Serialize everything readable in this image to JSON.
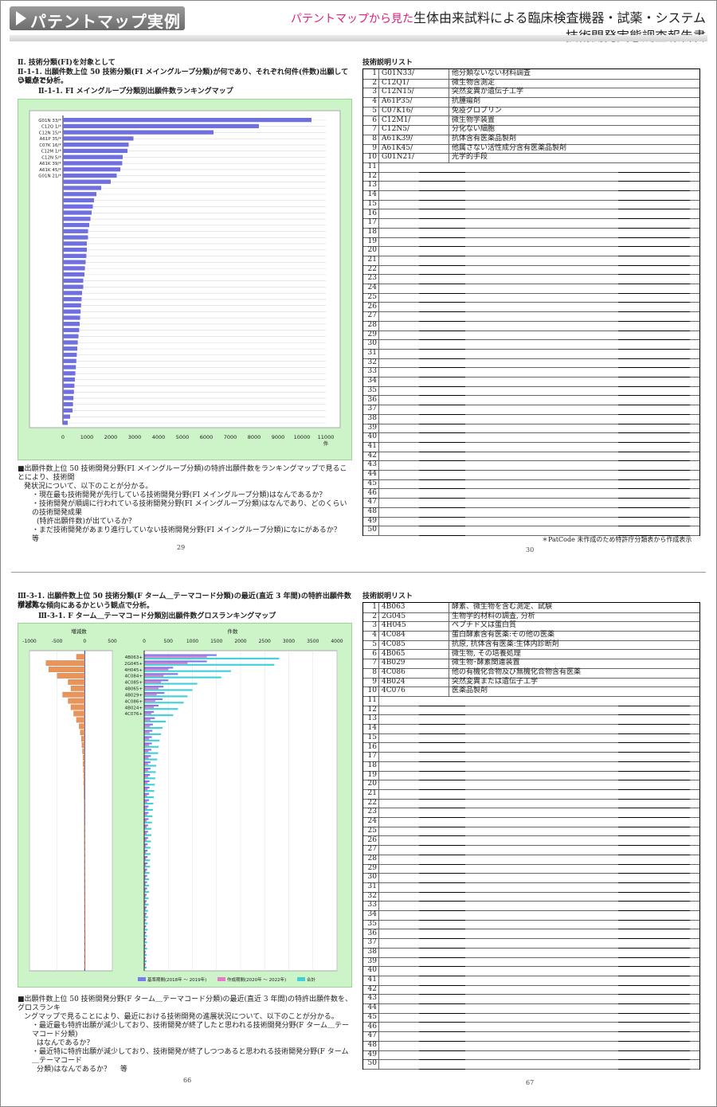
{
  "header": {
    "badge": "パテントマップ実例",
    "subtitle_pink": "パテントマップから見た",
    "title_line1": "生体由来試料による臨床検査機器・試薬・システム",
    "title_line2": "技術開発実態調査報告書"
  },
  "page1": {
    "section": "Ⅱ. 技術分類(FI)を対象として",
    "heading": "Ⅱ-1-1. 出願件数上位 50 技術分類(FI メイングループ分類)が何であり、それぞれ何件(件数)出願しているかとい",
    "heading2": "う観点で分析。",
    "chart_caption": "Ⅱ-1-1. FI メイングループ分類別出願件数ランキングマップ",
    "unit": "件",
    "notes": [
      "■出願件数上位 50 技術開発分野(FI メイングループ分類)の特許出願件数をランキングマップで見ることにより、技術開",
      "発状況について、以下のことが分かる。",
      "・現在最も技術開発が先行している技術開発分野(FI メイングループ分類)はなんであるか？",
      "・技術開発が順調に行われている技術開発分野(FI メイングループ分類)はなんであり、どのくらいの技術開発成果",
      "(特許出願件数)が出ているか？",
      "・まだ技術開発があまり進行していない技術開発分野(FI メイングループ分類)になにがあるか？　 等"
    ],
    "page_left": "29",
    "page_right": "30"
  },
  "techlist1": {
    "title": "技術説明リスト",
    "footnote": "＊PatCode 未作成のため特許庁分類表から作成表示",
    "rows": [
      {
        "n": "1",
        "code": "G01N33/",
        "desc": "他分類ないない材料調査"
      },
      {
        "n": "2",
        "code": "C12Q1/",
        "desc": "微生物含測定"
      },
      {
        "n": "3",
        "code": "C12N15/",
        "desc": "突然変異か遺伝子工学"
      },
      {
        "n": "4",
        "code": "A61P35/",
        "desc": "抗腫瘍剤"
      },
      {
        "n": "5",
        "code": "C07K16/",
        "desc": "免疫グロブリン"
      },
      {
        "n": "6",
        "code": "C12M1/",
        "desc": "微生物学装置"
      },
      {
        "n": "7",
        "code": "C12N5/",
        "desc": "分化ない細胞"
      },
      {
        "n": "8",
        "code": "A61K39/",
        "desc": "抗体含有医薬品製剤"
      },
      {
        "n": "9",
        "code": "A61K45/",
        "desc": "他属さない活性成分含有医薬品製剤"
      },
      {
        "n": "10",
        "code": "G01N21/",
        "desc": "光学的手段"
      },
      {
        "n": "11",
        "code": "",
        "desc": ""
      },
      {
        "n": "12",
        "code": "",
        "desc": ""
      },
      {
        "n": "13",
        "code": "",
        "desc": ""
      },
      {
        "n": "14",
        "code": "",
        "desc": ""
      },
      {
        "n": "15",
        "code": "",
        "desc": ""
      },
      {
        "n": "16",
        "code": "",
        "desc": ""
      },
      {
        "n": "17",
        "code": "",
        "desc": ""
      },
      {
        "n": "18",
        "code": "",
        "desc": ""
      },
      {
        "n": "19",
        "code": "",
        "desc": ""
      },
      {
        "n": "20",
        "code": "",
        "desc": ""
      },
      {
        "n": "21",
        "code": "",
        "desc": ""
      },
      {
        "n": "22",
        "code": "",
        "desc": ""
      },
      {
        "n": "23",
        "code": "",
        "desc": ""
      },
      {
        "n": "24",
        "code": "",
        "desc": ""
      },
      {
        "n": "25",
        "code": "",
        "desc": ""
      },
      {
        "n": "26",
        "code": "",
        "desc": ""
      },
      {
        "n": "27",
        "code": "",
        "desc": ""
      },
      {
        "n": "28",
        "code": "",
        "desc": ""
      },
      {
        "n": "29",
        "code": "",
        "desc": ""
      },
      {
        "n": "30",
        "code": "",
        "desc": ""
      },
      {
        "n": "31",
        "code": "",
        "desc": ""
      },
      {
        "n": "32",
        "code": "",
        "desc": ""
      },
      {
        "n": "33",
        "code": "",
        "desc": ""
      },
      {
        "n": "34",
        "code": "",
        "desc": ""
      },
      {
        "n": "35",
        "code": "",
        "desc": ""
      },
      {
        "n": "36",
        "code": "",
        "desc": ""
      },
      {
        "n": "37",
        "code": "",
        "desc": ""
      },
      {
        "n": "38",
        "code": "",
        "desc": ""
      },
      {
        "n": "39",
        "code": "",
        "desc": ""
      },
      {
        "n": "40",
        "code": "",
        "desc": ""
      },
      {
        "n": "41",
        "code": "",
        "desc": ""
      },
      {
        "n": "42",
        "code": "",
        "desc": ""
      },
      {
        "n": "43",
        "code": "",
        "desc": ""
      },
      {
        "n": "44",
        "code": "",
        "desc": ""
      },
      {
        "n": "45",
        "code": "",
        "desc": ""
      },
      {
        "n": "46",
        "code": "",
        "desc": ""
      },
      {
        "n": "47",
        "code": "",
        "desc": ""
      },
      {
        "n": "48",
        "code": "",
        "desc": ""
      },
      {
        "n": "49",
        "code": "",
        "desc": ""
      },
      {
        "n": "50",
        "code": "",
        "desc": ""
      }
    ]
  },
  "page2": {
    "heading": "Ⅲ-3-1. 出願件数上位 50 技術分類(F ターム＿テーマコード分類)の最近(直近 3 年間)の特許出願件数増減数",
    "heading2": "がどんな傾向にあるかという観点で分析。",
    "chart_caption": "Ⅲ-3-1. F ターム＿テーマコード分類別出願件数グロスランキングマップ",
    "left_axis_title": "増減数",
    "right_axis_title": "件数",
    "notes": [
      "■出願件数上位 50 技術開発分野(F ターム＿テーマコード分類)の最近(直近 3 年間)の特許出願件数を、グロスランキ",
      "ングマップで見ることにより、最近における技術開発の進展状況について、以下のことが分かる。",
      "・最近最も特許出願が減少しており、技術開発が終了したと思われる技術開発分野(F ターム＿テーマコード分類)",
      "はなんであるか？",
      "・最近特に特許出願が減少しており、技術開発が終了しつつあると思われる技術開発分野(F ターム＿テーマコード",
      "分類)はなんであるか？　 等"
    ],
    "page_left": "66",
    "page_right": "67"
  },
  "techlist2": {
    "title": "技術説明リスト",
    "rows": [
      {
        "n": "1",
        "code": "4B063",
        "desc": "酵素、微生物を含む測定、試験"
      },
      {
        "n": "2",
        "code": "2G045",
        "desc": "生物学的材料の調査, 分析"
      },
      {
        "n": "3",
        "code": "4H045",
        "desc": "ペプチド又は蛋白質"
      },
      {
        "n": "4",
        "code": "4C084",
        "desc": "蛋白酵素含有医薬:その他の医薬"
      },
      {
        "n": "5",
        "code": "4C085",
        "desc": "抗原, 抗体含有医薬:生体内診断剤"
      },
      {
        "n": "6",
        "code": "4B065",
        "desc": "微生物, その培養処理"
      },
      {
        "n": "7",
        "code": "4B029",
        "desc": "微生物･酵素関連装置"
      },
      {
        "n": "8",
        "code": "4C086",
        "desc": "他の有機化合物及び無機化合物含有医薬"
      },
      {
        "n": "9",
        "code": "4B024",
        "desc": "突然変異または遺伝子工学"
      },
      {
        "n": "10",
        "code": "4C076",
        "desc": "医薬品製剤"
      },
      {
        "n": "11",
        "code": "",
        "desc": ""
      },
      {
        "n": "12",
        "code": "",
        "desc": ""
      },
      {
        "n": "13",
        "code": "",
        "desc": ""
      },
      {
        "n": "14",
        "code": "",
        "desc": ""
      },
      {
        "n": "15",
        "code": "",
        "desc": ""
      },
      {
        "n": "16",
        "code": "",
        "desc": ""
      },
      {
        "n": "17",
        "code": "",
        "desc": ""
      },
      {
        "n": "18",
        "code": "",
        "desc": ""
      },
      {
        "n": "19",
        "code": "",
        "desc": ""
      },
      {
        "n": "20",
        "code": "",
        "desc": ""
      },
      {
        "n": "21",
        "code": "",
        "desc": ""
      },
      {
        "n": "22",
        "code": "",
        "desc": ""
      },
      {
        "n": "23",
        "code": "",
        "desc": ""
      },
      {
        "n": "24",
        "code": "",
        "desc": ""
      },
      {
        "n": "25",
        "code": "",
        "desc": ""
      },
      {
        "n": "26",
        "code": "",
        "desc": ""
      },
      {
        "n": "27",
        "code": "",
        "desc": ""
      },
      {
        "n": "28",
        "code": "",
        "desc": ""
      },
      {
        "n": "29",
        "code": "",
        "desc": ""
      },
      {
        "n": "30",
        "code": "",
        "desc": ""
      },
      {
        "n": "31",
        "code": "",
        "desc": ""
      },
      {
        "n": "32",
        "code": "",
        "desc": ""
      },
      {
        "n": "33",
        "code": "",
        "desc": ""
      },
      {
        "n": "34",
        "code": "",
        "desc": ""
      },
      {
        "n": "35",
        "code": "",
        "desc": ""
      },
      {
        "n": "36",
        "code": "",
        "desc": ""
      },
      {
        "n": "37",
        "code": "",
        "desc": ""
      },
      {
        "n": "38",
        "code": "",
        "desc": ""
      },
      {
        "n": "39",
        "code": "",
        "desc": ""
      },
      {
        "n": "40",
        "code": "",
        "desc": ""
      },
      {
        "n": "41",
        "code": "",
        "desc": ""
      },
      {
        "n": "42",
        "code": "",
        "desc": ""
      },
      {
        "n": "43",
        "code": "",
        "desc": ""
      },
      {
        "n": "44",
        "code": "",
        "desc": ""
      },
      {
        "n": "45",
        "code": "",
        "desc": ""
      },
      {
        "n": "46",
        "code": "",
        "desc": ""
      },
      {
        "n": "47",
        "code": "",
        "desc": ""
      },
      {
        "n": "48",
        "code": "",
        "desc": ""
      },
      {
        "n": "49",
        "code": "",
        "desc": ""
      },
      {
        "n": "50",
        "code": "",
        "desc": ""
      }
    ]
  },
  "chart_data": [
    {
      "type": "bar",
      "orientation": "horizontal",
      "categories": [
        "G01N 33/*",
        "C12Q 1/*",
        "C12N 15/*",
        "A61P 35/*",
        "C07K 16/*",
        "C12M 1/*",
        "C12N 5/*",
        "A61K 39/*",
        "A61K 45/*",
        "G01N 21/*"
      ],
      "values": [
        10400,
        8200,
        6300,
        2950,
        2750,
        2700,
        2500,
        2480,
        2400,
        2250,
        2000,
        1600,
        1400,
        1300,
        1250,
        1200,
        1150,
        1100,
        1050,
        1050,
        1000,
        1000,
        980,
        950,
        920,
        900,
        850,
        850,
        800,
        780,
        760,
        740,
        720,
        700,
        680,
        650,
        620,
        600,
        580,
        560,
        540,
        520,
        500,
        480,
        460,
        440,
        420,
        400,
        300,
        200
      ],
      "xticks": [
        "0",
        "1000",
        "2000",
        "3000",
        "4000",
        "5000",
        "6000",
        "7000",
        "8000",
        "9000",
        "10000",
        "11000"
      ],
      "xlim": [
        0,
        11000
      ],
      "xlabel": "件",
      "color": "#6f6fe0"
    },
    {
      "type": "bar",
      "orientation": "horizontal",
      "categories": [
        "4B063+",
        "2G045+",
        "4H045+",
        "4C084+",
        "4C085+",
        "4B065+",
        "4B029+",
        "4C086+",
        "4B024+",
        "4C076+"
      ],
      "left_panel": {
        "title": "増減数",
        "xticks": [
          "-1000",
          "-500",
          "0",
          "500"
        ],
        "xlim": [
          -1000,
          500
        ],
        "values": [
          -150,
          -700,
          -650,
          -500,
          -300,
          -250,
          -400,
          -300,
          -250,
          -200,
          -150,
          -100,
          -80,
          -60,
          -50,
          -40,
          -30,
          -30,
          -25,
          -20,
          -20,
          -15,
          -15,
          -10,
          -10,
          -10,
          -10,
          -8,
          -8,
          -6,
          -6,
          -5,
          -5,
          -5,
          -4,
          -4,
          -3,
          -3,
          -3,
          -2,
          -2,
          -2,
          -2,
          -2,
          -1,
          -1,
          -1,
          -1,
          -1,
          -1
        ],
        "color": "#e8945a"
      },
      "right_panel": {
        "title": "件数",
        "xticks": [
          "0",
          "500",
          "1000",
          "1500",
          "2000",
          "2500",
          "3000",
          "3500",
          "4000"
        ],
        "xlim": [
          0,
          4000
        ],
        "series": [
          {
            "name": "基準期間(2018年 〜 2019年)",
            "color": "#7a7af0",
            "values": [
              1500,
              1300,
              600,
              700,
              500,
              400,
              420,
              380,
              300,
              200,
              220,
              180,
              170,
              160,
              160,
              150,
              140,
              130,
              130,
              120,
              110,
              110,
              100,
              100,
              90,
              90,
              90,
              80,
              80,
              80,
              70,
              70,
              70,
              70,
              60,
              60,
              60,
              60,
              50,
              50,
              50,
              50,
              40,
              40,
              40,
              40,
              30,
              30,
              30,
              30
            ]
          },
          {
            "name": "作成期間(2020年 〜 2022年)",
            "color": "#e878c8",
            "values": [
              1300,
              900,
              500,
              400,
              350,
              300,
              260,
              230,
              200,
              150,
              130,
              120,
              110,
              100,
              100,
              90,
              90,
              80,
              80,
              80,
              70,
              70,
              60,
              60,
              60,
              60,
              50,
              50,
              50,
              50,
              40,
              40,
              40,
              40,
              40,
              30,
              30,
              30,
              30,
              30,
              30,
              30,
              20,
              20,
              20,
              20,
              20,
              20,
              20,
              20
            ]
          },
          {
            "name": "合計",
            "color": "#40d0d8",
            "values": [
              2800,
              2700,
              1800,
              1600,
              1100,
              1000,
              900,
              820,
              700,
              600,
              450,
              380,
              350,
              320,
              300,
              290,
              270,
              250,
              240,
              230,
              220,
              210,
              200,
              190,
              180,
              170,
              160,
              150,
              150,
              140,
              130,
              130,
              120,
              120,
              110,
              100,
              100,
              100,
              90,
              90,
              80,
              80,
              70,
              70,
              60,
              60,
              60,
              50,
              50,
              50
            ]
          }
        ]
      }
    }
  ]
}
